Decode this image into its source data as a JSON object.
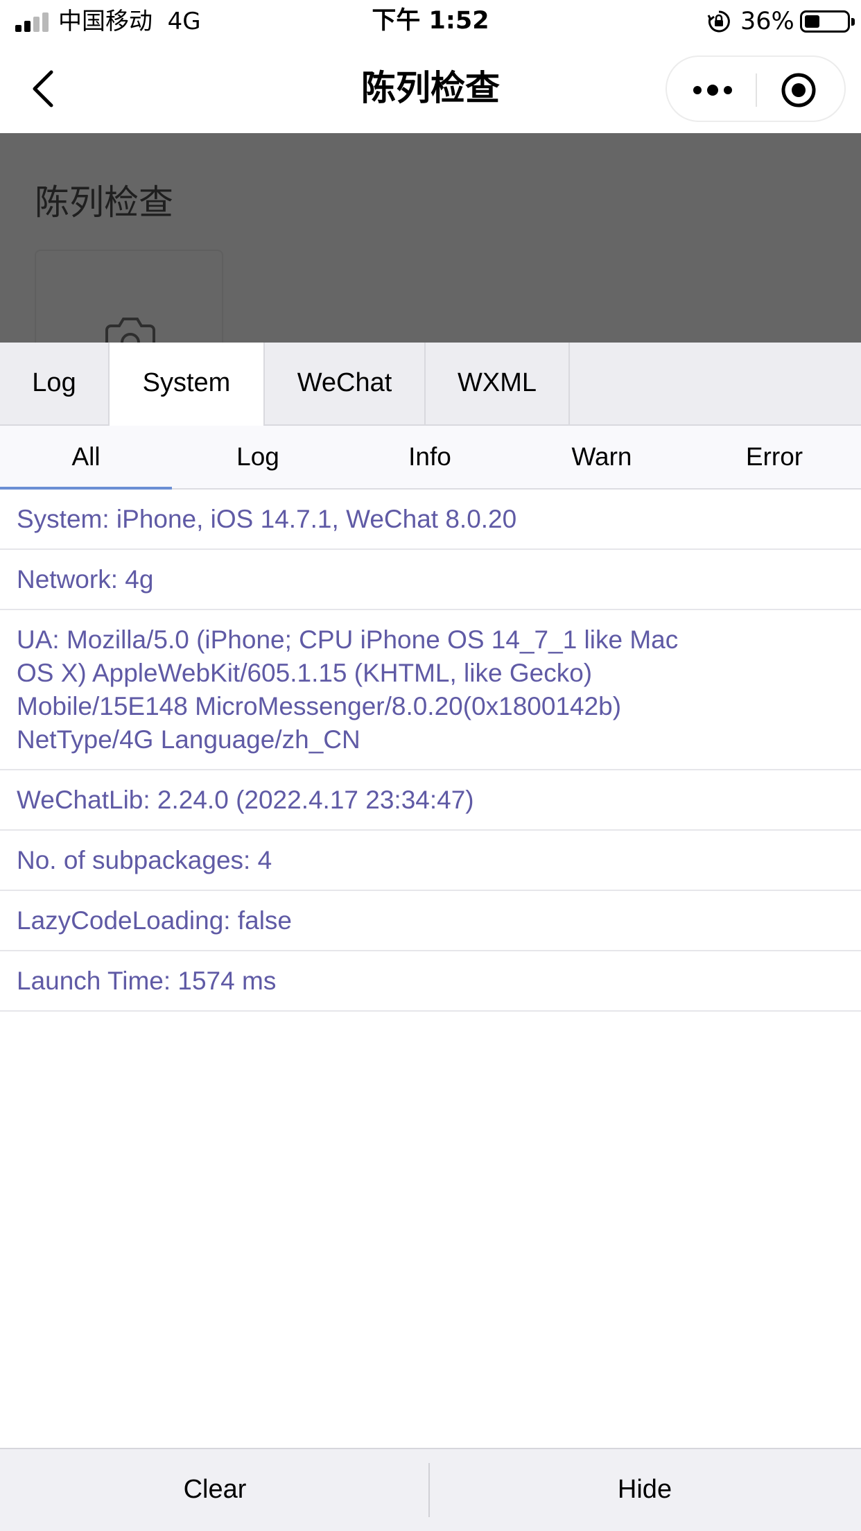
{
  "status_bar": {
    "carrier": "中国移动",
    "network": "4G",
    "time": "下午 1:52",
    "battery_percent": "36%",
    "battery_level": 0.36
  },
  "nav": {
    "title": "陈列检查"
  },
  "page": {
    "heading": "陈列检查"
  },
  "console": {
    "tabs": [
      {
        "label": "Log"
      },
      {
        "label": "System"
      },
      {
        "label": "WeChat"
      },
      {
        "label": "WXML"
      }
    ],
    "active_tab": "System",
    "filters": [
      {
        "label": "All"
      },
      {
        "label": "Log"
      },
      {
        "label": "Info"
      },
      {
        "label": "Warn"
      },
      {
        "label": "Error"
      }
    ],
    "active_filter": "All",
    "logs": [
      {
        "lines": [
          "System: iPhone, iOS 14.7.1, WeChat 8.0.20"
        ]
      },
      {
        "lines": [
          "Network: 4g"
        ]
      },
      {
        "lines": [
          "UA: Mozilla/5.0 (iPhone; CPU iPhone OS 14_7_1 like Mac",
          "OS X) AppleWebKit/605.1.15 (KHTML, like Gecko)",
          "Mobile/15E148 MicroMessenger/8.0.20(0x1800142b)",
          "NetType/4G Language/zh_CN"
        ]
      },
      {
        "lines": [
          "WeChatLib: 2.24.0 (2022.4.17 23:34:47)"
        ]
      },
      {
        "lines": [
          "No. of subpackages: 4"
        ]
      },
      {
        "lines": [
          "LazyCodeLoading: false"
        ]
      },
      {
        "lines": [
          "Launch Time: 1574 ms"
        ]
      }
    ],
    "toolbar": {
      "clear_label": "Clear",
      "hide_label": "Hide"
    }
  },
  "colors": {
    "log_text": "#5f5aa5",
    "active_underline": "#6b8fd4",
    "overlay": "#666666"
  }
}
